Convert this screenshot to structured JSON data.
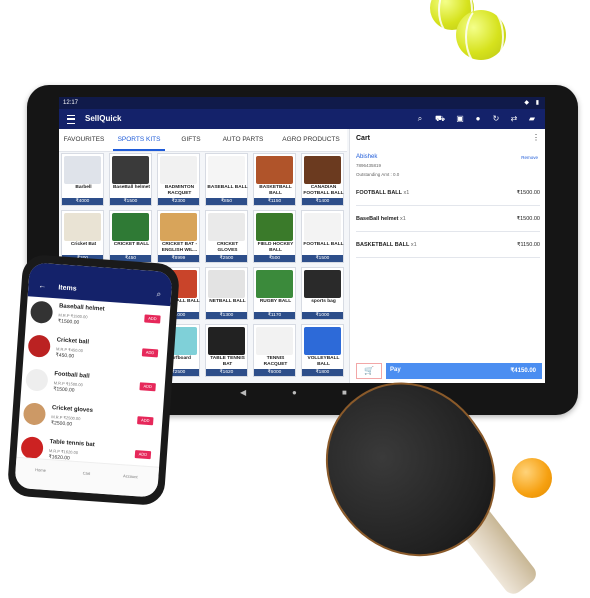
{
  "status_bar": {
    "time": "12:17"
  },
  "app": {
    "title": "SellQuick"
  },
  "tabs": [
    {
      "label": "FAVOURITES"
    },
    {
      "label": "SPORTS KITS"
    },
    {
      "label": "GIFTS"
    },
    {
      "label": "AUTO PARTS"
    },
    {
      "label": "AGRO PRODUCTS"
    }
  ],
  "products": [
    {
      "name": "Barbell",
      "price": "₹4000"
    },
    {
      "name": "BaseBall helmet",
      "price": "₹1500"
    },
    {
      "name": "BADMINTON RACQUET",
      "price": "₹2300"
    },
    {
      "name": "BASEBALL BALL",
      "price": "₹850"
    },
    {
      "name": "BASKETBALL BALL",
      "price": "₹1150"
    },
    {
      "name": "CANADIAN FOOTBALL BALL",
      "price": "₹1400"
    },
    {
      "name": "Cricket Bat",
      "price": "₹300"
    },
    {
      "name": "CRICKET BALL",
      "price": "₹450"
    },
    {
      "name": "CRICKET BAT - ENGLISH WIL...",
      "price": "₹8999"
    },
    {
      "name": "CRICKET GLOVES",
      "price": "₹2500"
    },
    {
      "name": "FIELD HOCKEY BALL",
      "price": "₹500"
    },
    {
      "name": "FOOTBALL BALL",
      "price": "₹1500"
    },
    {
      "name": "",
      "price": ""
    },
    {
      "name": "",
      "price": ""
    },
    {
      "name": "HANDBALL BALL",
      "price": "₹1000"
    },
    {
      "name": "NETBALL BALL",
      "price": "₹1300"
    },
    {
      "name": "RUGBY BALL",
      "price": "₹1170"
    },
    {
      "name": "sports bag",
      "price": "₹1000"
    },
    {
      "name": "",
      "price": ""
    },
    {
      "name": "",
      "price": ""
    },
    {
      "name": "Surfboard",
      "price": "₹2500"
    },
    {
      "name": "TABLE TENNIS BAT",
      "price": "₹1620"
    },
    {
      "name": "TENNIS RACQUET",
      "price": "₹6000"
    },
    {
      "name": "VOLLEYBALL BALL",
      "price": "₹1800"
    }
  ],
  "cart": {
    "title": "Cart",
    "more": "⋮",
    "customer": "Abishek",
    "remove": "Remove",
    "phone": "7896435819",
    "outstanding": "Outstanding Amt : 0.0",
    "items": [
      {
        "name": "FOOTBALL BALL",
        "qty": "x1",
        "amount": "₹1500.00"
      },
      {
        "name": "BaseBall helmet",
        "qty": "x1",
        "amount": "₹1500.00"
      },
      {
        "name": "BASKETBALL BALL",
        "qty": "x1",
        "amount": "₹1150.00"
      }
    ],
    "pay_label": "Pay",
    "total": "₹4150.00"
  },
  "phone": {
    "title": "Items",
    "items": [
      {
        "name": "Baseball helmet",
        "meta": "M.R.P ₹1500.00",
        "price": "₹1500.00",
        "add": "ADD"
      },
      {
        "name": "Cricket ball",
        "meta": "M.R.P ₹450.00",
        "price": "₹450.00",
        "add": "ADD"
      },
      {
        "name": "Football ball",
        "meta": "M.R.P ₹1500.00",
        "price": "₹1500.00",
        "add": "ADD"
      },
      {
        "name": "Cricket gloves",
        "meta": "M.R.P ₹2500.00",
        "price": "₹2500.00",
        "add": "ADD"
      },
      {
        "name": "Table tennis bat",
        "meta": "M.R.P ₹1620.00",
        "price": "₹1620.00",
        "add": "ADD"
      }
    ],
    "footer": [
      "Home",
      "Cart",
      "Account"
    ]
  },
  "icons": [
    "search-icon",
    "cart-icon",
    "scan-icon",
    "mic-icon",
    "refresh-icon",
    "chat-icon"
  ],
  "colors": {
    "header": "#14226a",
    "accent": "#1e5bd8",
    "pay": "#4b8ef1",
    "add_badge": "#e6285a"
  }
}
